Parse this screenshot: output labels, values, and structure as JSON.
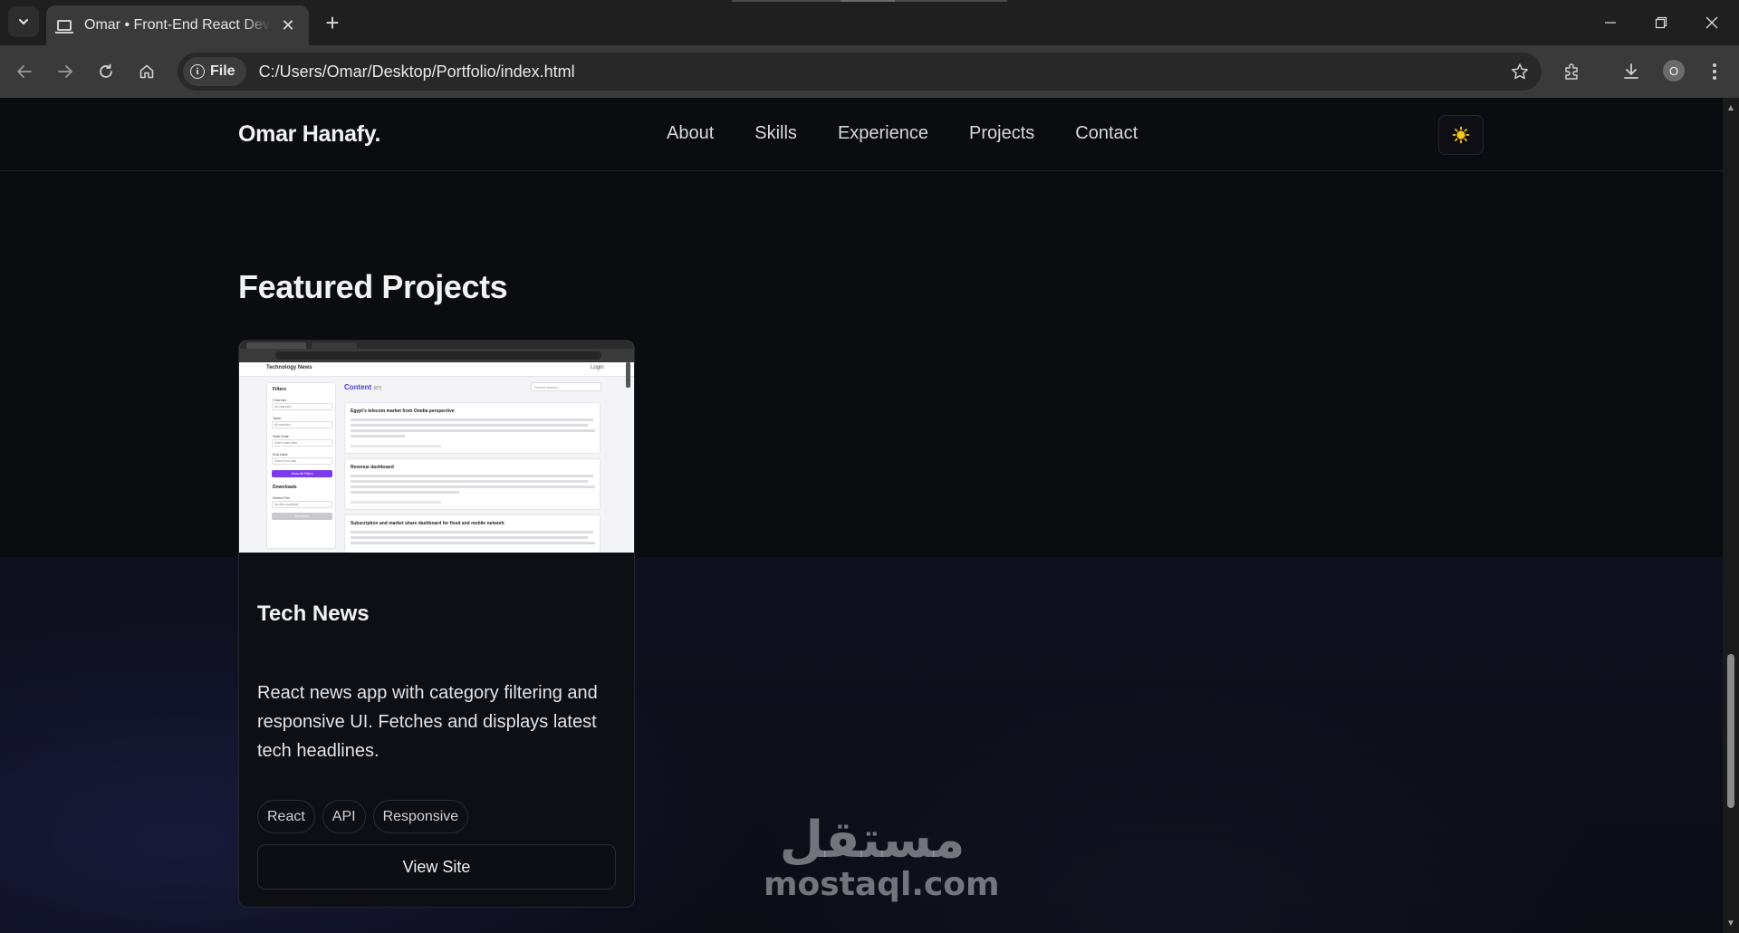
{
  "browser": {
    "tab_title": "Omar • Front-End React Developer",
    "address_chip": "File",
    "url": "C:/Users/Omar/Desktop/Portfolio/index.html",
    "profile_initial": "O"
  },
  "site": {
    "brand": "Omar Hanafy.",
    "nav": [
      "About",
      "Skills",
      "Experience",
      "Projects",
      "Contact"
    ],
    "accent_color": "#f5c518"
  },
  "projects": {
    "title": "Featured Projects",
    "items": [
      {
        "title": "Tech News",
        "description": "React news app with category filtering and responsive UI. Fetches and displays latest tech headlines.",
        "tags": [
          "React",
          "API",
          "Responsive"
        ],
        "cta": "View Site",
        "screenshot": {
          "app_name": "Technology News",
          "login": "Login",
          "content_heading": "Content",
          "content_count": "(87)",
          "search_placeholder": "Search articles",
          "sidebar": {
            "filters_heading": "Filters",
            "fields": [
              "Channel",
              "Topic",
              "Start Date",
              "End Date"
            ],
            "field_values": [
              "All channels",
              "All selected",
              "Select start date",
              "Select end date"
            ],
            "apply_button": "Show All Filters",
            "downloads_heading": "Downloads",
            "select_file_label": "Select File",
            "select_file_value": "No files available",
            "download_button": "Download"
          },
          "articles": [
            "Egypt's telecom market from Omdia perspective",
            "Revenue dashboard",
            "Subscription and market share dashboard for fixed and mobile network"
          ]
        }
      }
    ]
  },
  "watermark": {
    "arabic": "مستقل",
    "latin": "mostaql.com"
  }
}
